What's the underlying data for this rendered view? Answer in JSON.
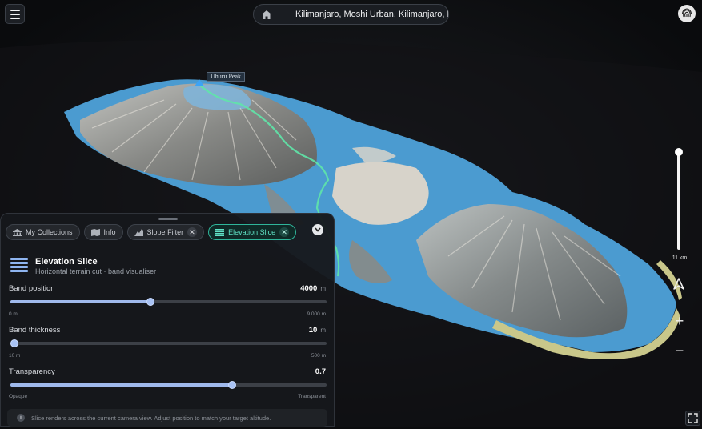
{
  "header": {
    "search_query": "Kilimanjaro, Moshi Urban, Kilimanjaro, N",
    "menu_icon": "hamburger-menu-icon",
    "home_icon": "home-icon",
    "profile_icon": "fingerprint-icon"
  },
  "map": {
    "peak_label": "Uhuru Peak",
    "scale_label": "11 km"
  },
  "controls": {
    "zoom_in": "+",
    "zoom_out": "−"
  },
  "panel": {
    "tabs": [
      {
        "label": "My Collections",
        "icon": "collection-icon",
        "closable": false,
        "active": false
      },
      {
        "label": "Info",
        "icon": "info-icon",
        "closable": false,
        "active": false
      },
      {
        "label": "Slope Filter",
        "icon": "slope-icon",
        "closable": true,
        "active": false
      },
      {
        "label": "Elevation Slice",
        "icon": "layers-icon",
        "closable": true,
        "active": true
      }
    ],
    "title": "Elevation Slice",
    "subtitle": "Horizontal terrain cut · band visualiser",
    "band_position": {
      "label": "Band position",
      "value": "4000",
      "unit": "m",
      "min_label": "0 m",
      "max_label": "9 000 m",
      "fraction": 0.444
    },
    "band_thickness": {
      "label": "Band thickness",
      "value": "10",
      "unit": "m",
      "min_label": "10 m",
      "max_label": "500 m",
      "fraction": 0.0
    },
    "transparency": {
      "label": "Transparency",
      "value": "0.7",
      "min_label": "Opaque",
      "max_label": "Transparent",
      "fraction": 0.7
    },
    "note": "Slice renders across the current camera view. Adjust position to match your target altitude."
  },
  "colors": {
    "accent_teal": "#2fb59a",
    "slider_blue": "#9fb9ec",
    "water_blue": "#4b9bd0"
  }
}
